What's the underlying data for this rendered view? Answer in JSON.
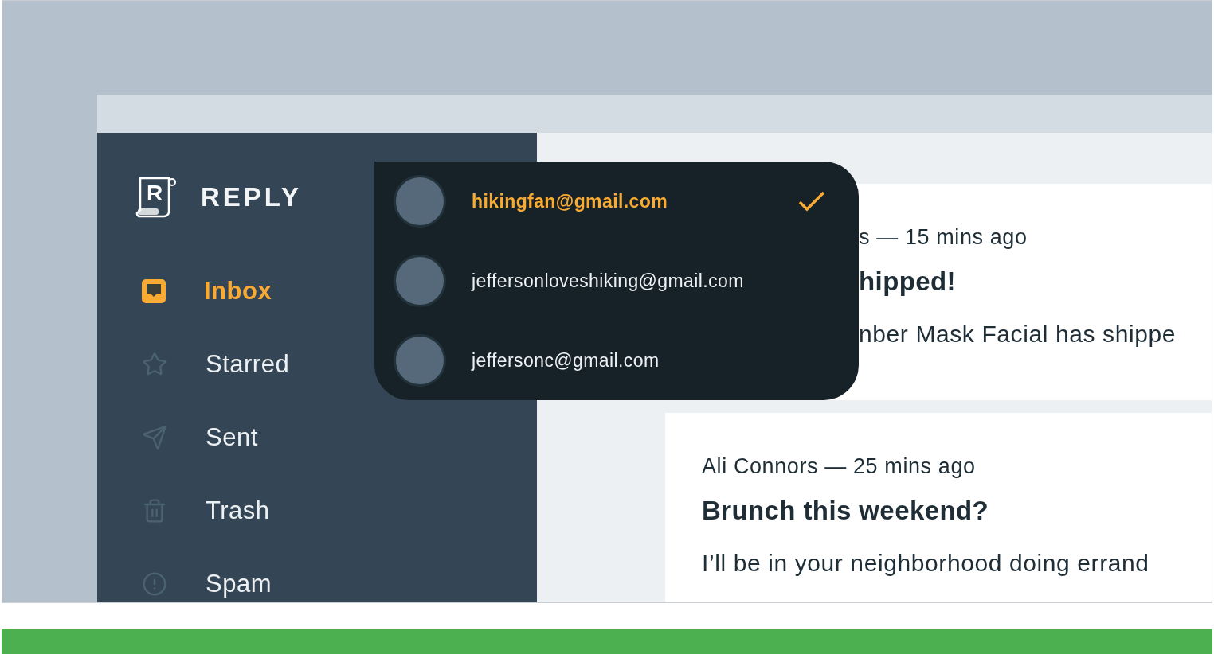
{
  "app": {
    "logo_mark": "R",
    "title": "REPLY"
  },
  "nav": [
    {
      "label": "Inbox",
      "kind": "inbox",
      "selected": true
    },
    {
      "label": "Starred",
      "kind": "starred",
      "selected": false
    },
    {
      "label": "Sent",
      "kind": "sent",
      "selected": false
    },
    {
      "label": "Trash",
      "kind": "trash",
      "selected": false
    },
    {
      "label": "Spam",
      "kind": "spam",
      "selected": false
    }
  ],
  "accounts": [
    {
      "email": "hikingfan@gmail.com",
      "selected": true
    },
    {
      "email": "jeffersonloveshiking@gmail.com",
      "selected": false
    },
    {
      "email": "jeffersonc@gmail.com",
      "selected": false
    }
  ],
  "emails": [
    {
      "meta": "s — 15 mins ago",
      "subject": "hipped!",
      "preview": "nber Mask Facial has shippe",
      "covered": true
    },
    {
      "meta": "Ali Connors — 25 mins ago",
      "subject": "Brunch this weekend?",
      "preview": "I’ll be in your neighborhood doing errand",
      "covered": false
    }
  ]
}
